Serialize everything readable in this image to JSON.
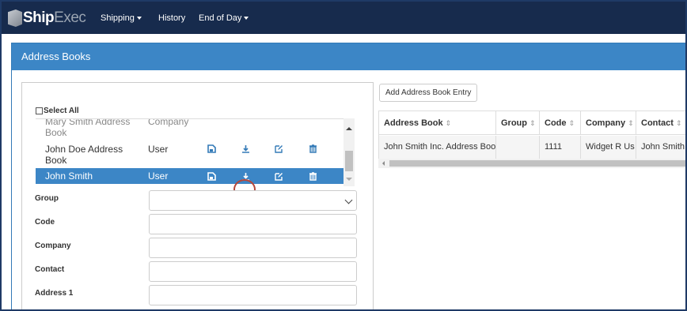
{
  "app": {
    "logo_ship": "Ship",
    "logo_exec": "Exec"
  },
  "nav": {
    "items": [
      {
        "label": "Shipping",
        "dropdown": true
      },
      {
        "label": "History",
        "dropdown": false
      },
      {
        "label": "End of Day",
        "dropdown": true
      }
    ]
  },
  "panel": {
    "title": "Address Books"
  },
  "list": {
    "select_all_label": "Select All",
    "rows": [
      {
        "name": "Mary Smith Address Book",
        "type": "Company",
        "selected": false
      },
      {
        "name": "John Doe Address Book",
        "type": "User",
        "selected": false
      },
      {
        "name": "John Smith",
        "type": "User",
        "selected": true
      }
    ],
    "row_icons": [
      "save-icon",
      "download-icon",
      "edit-icon",
      "trash-icon"
    ]
  },
  "form": {
    "fields": [
      {
        "label": "Group",
        "value": "",
        "type": "select"
      },
      {
        "label": "Code",
        "value": "",
        "type": "text"
      },
      {
        "label": "Company",
        "value": "",
        "type": "text"
      },
      {
        "label": "Contact",
        "value": "",
        "type": "text"
      },
      {
        "label": "Address 1",
        "value": "",
        "type": "text"
      }
    ]
  },
  "table": {
    "add_button_label": "Add Address Book Entry",
    "columns": [
      "Address Book",
      "Group",
      "Code",
      "Company",
      "Contact"
    ],
    "sort_glyph": "⇕",
    "rows": [
      [
        "John Smith Inc. Address Book",
        "",
        "1111",
        "Widget R Us",
        "John Smith"
      ]
    ]
  },
  "colors": {
    "navbar": "#172b4d",
    "panel_header": "#3c86c6",
    "selected_row": "#3c86c6",
    "highlight_ring": "#b5473a"
  }
}
